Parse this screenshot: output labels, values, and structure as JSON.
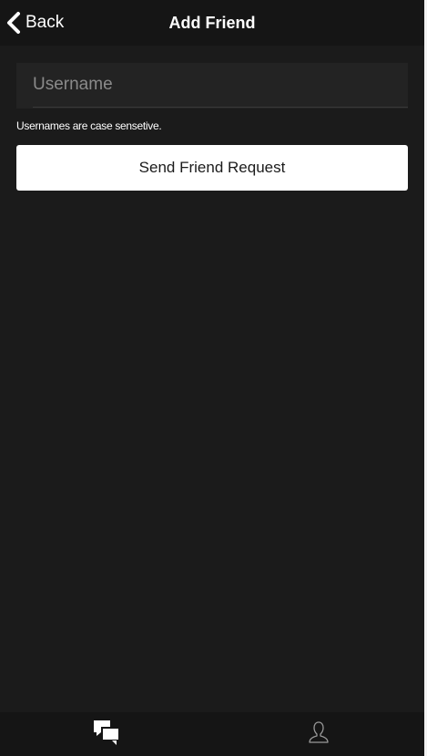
{
  "header": {
    "back_label": "Back",
    "title": "Add Friend"
  },
  "form": {
    "username_placeholder": "Username",
    "username_value": "",
    "hint": "Usernames are case sensetive.",
    "send_label": "Send Friend Request"
  },
  "bottom_nav": {
    "tabs": [
      {
        "icon": "chat-bubbles-icon",
        "active": true
      },
      {
        "icon": "person-icon",
        "active": false
      }
    ]
  },
  "colors": {
    "background": "#1b1b1b",
    "bar": "#151515",
    "field": "#232323",
    "text": "#ffffff",
    "placeholder": "#8a8a8a",
    "button": "#ffffff"
  }
}
